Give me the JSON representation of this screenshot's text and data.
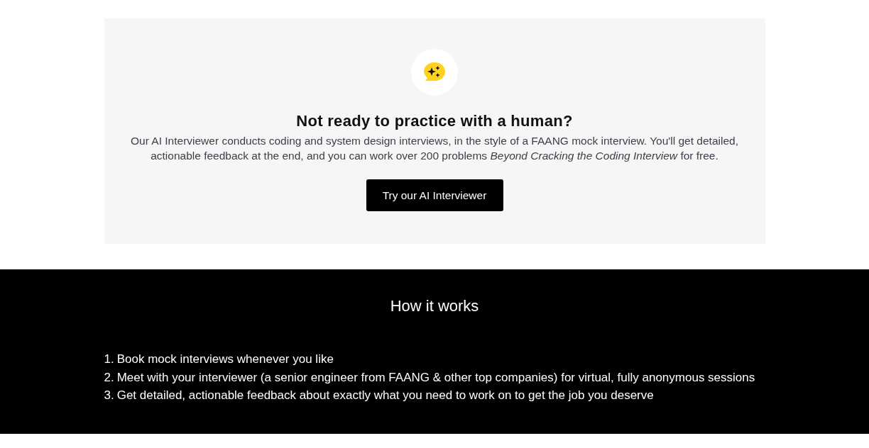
{
  "promo": {
    "heading": "Not ready to practice with a human?",
    "description": "Our AI Interviewer conducts coding and system design interviews, in the style of a FAANG mock interview. You'll get detailed, actionable feedback at the end, and you can work over 200 problems *Beyond Cracking the Coding Interview* for free.",
    "button": "Try our AI Interviewer"
  },
  "how_it_works": {
    "heading": "How it works",
    "steps": [
      {
        "number": "1.",
        "text": "Book mock interviews whenever you like"
      },
      {
        "number": "2.",
        "text": "Meet with your interviewer (a senior engineer from FAANG & other top companies) for virtual, fully anonymous sessions"
      },
      {
        "number": "3.",
        "text": "Get detailed, actionable feedback about exactly what you need to work on to get the job you deserve"
      }
    ]
  }
}
